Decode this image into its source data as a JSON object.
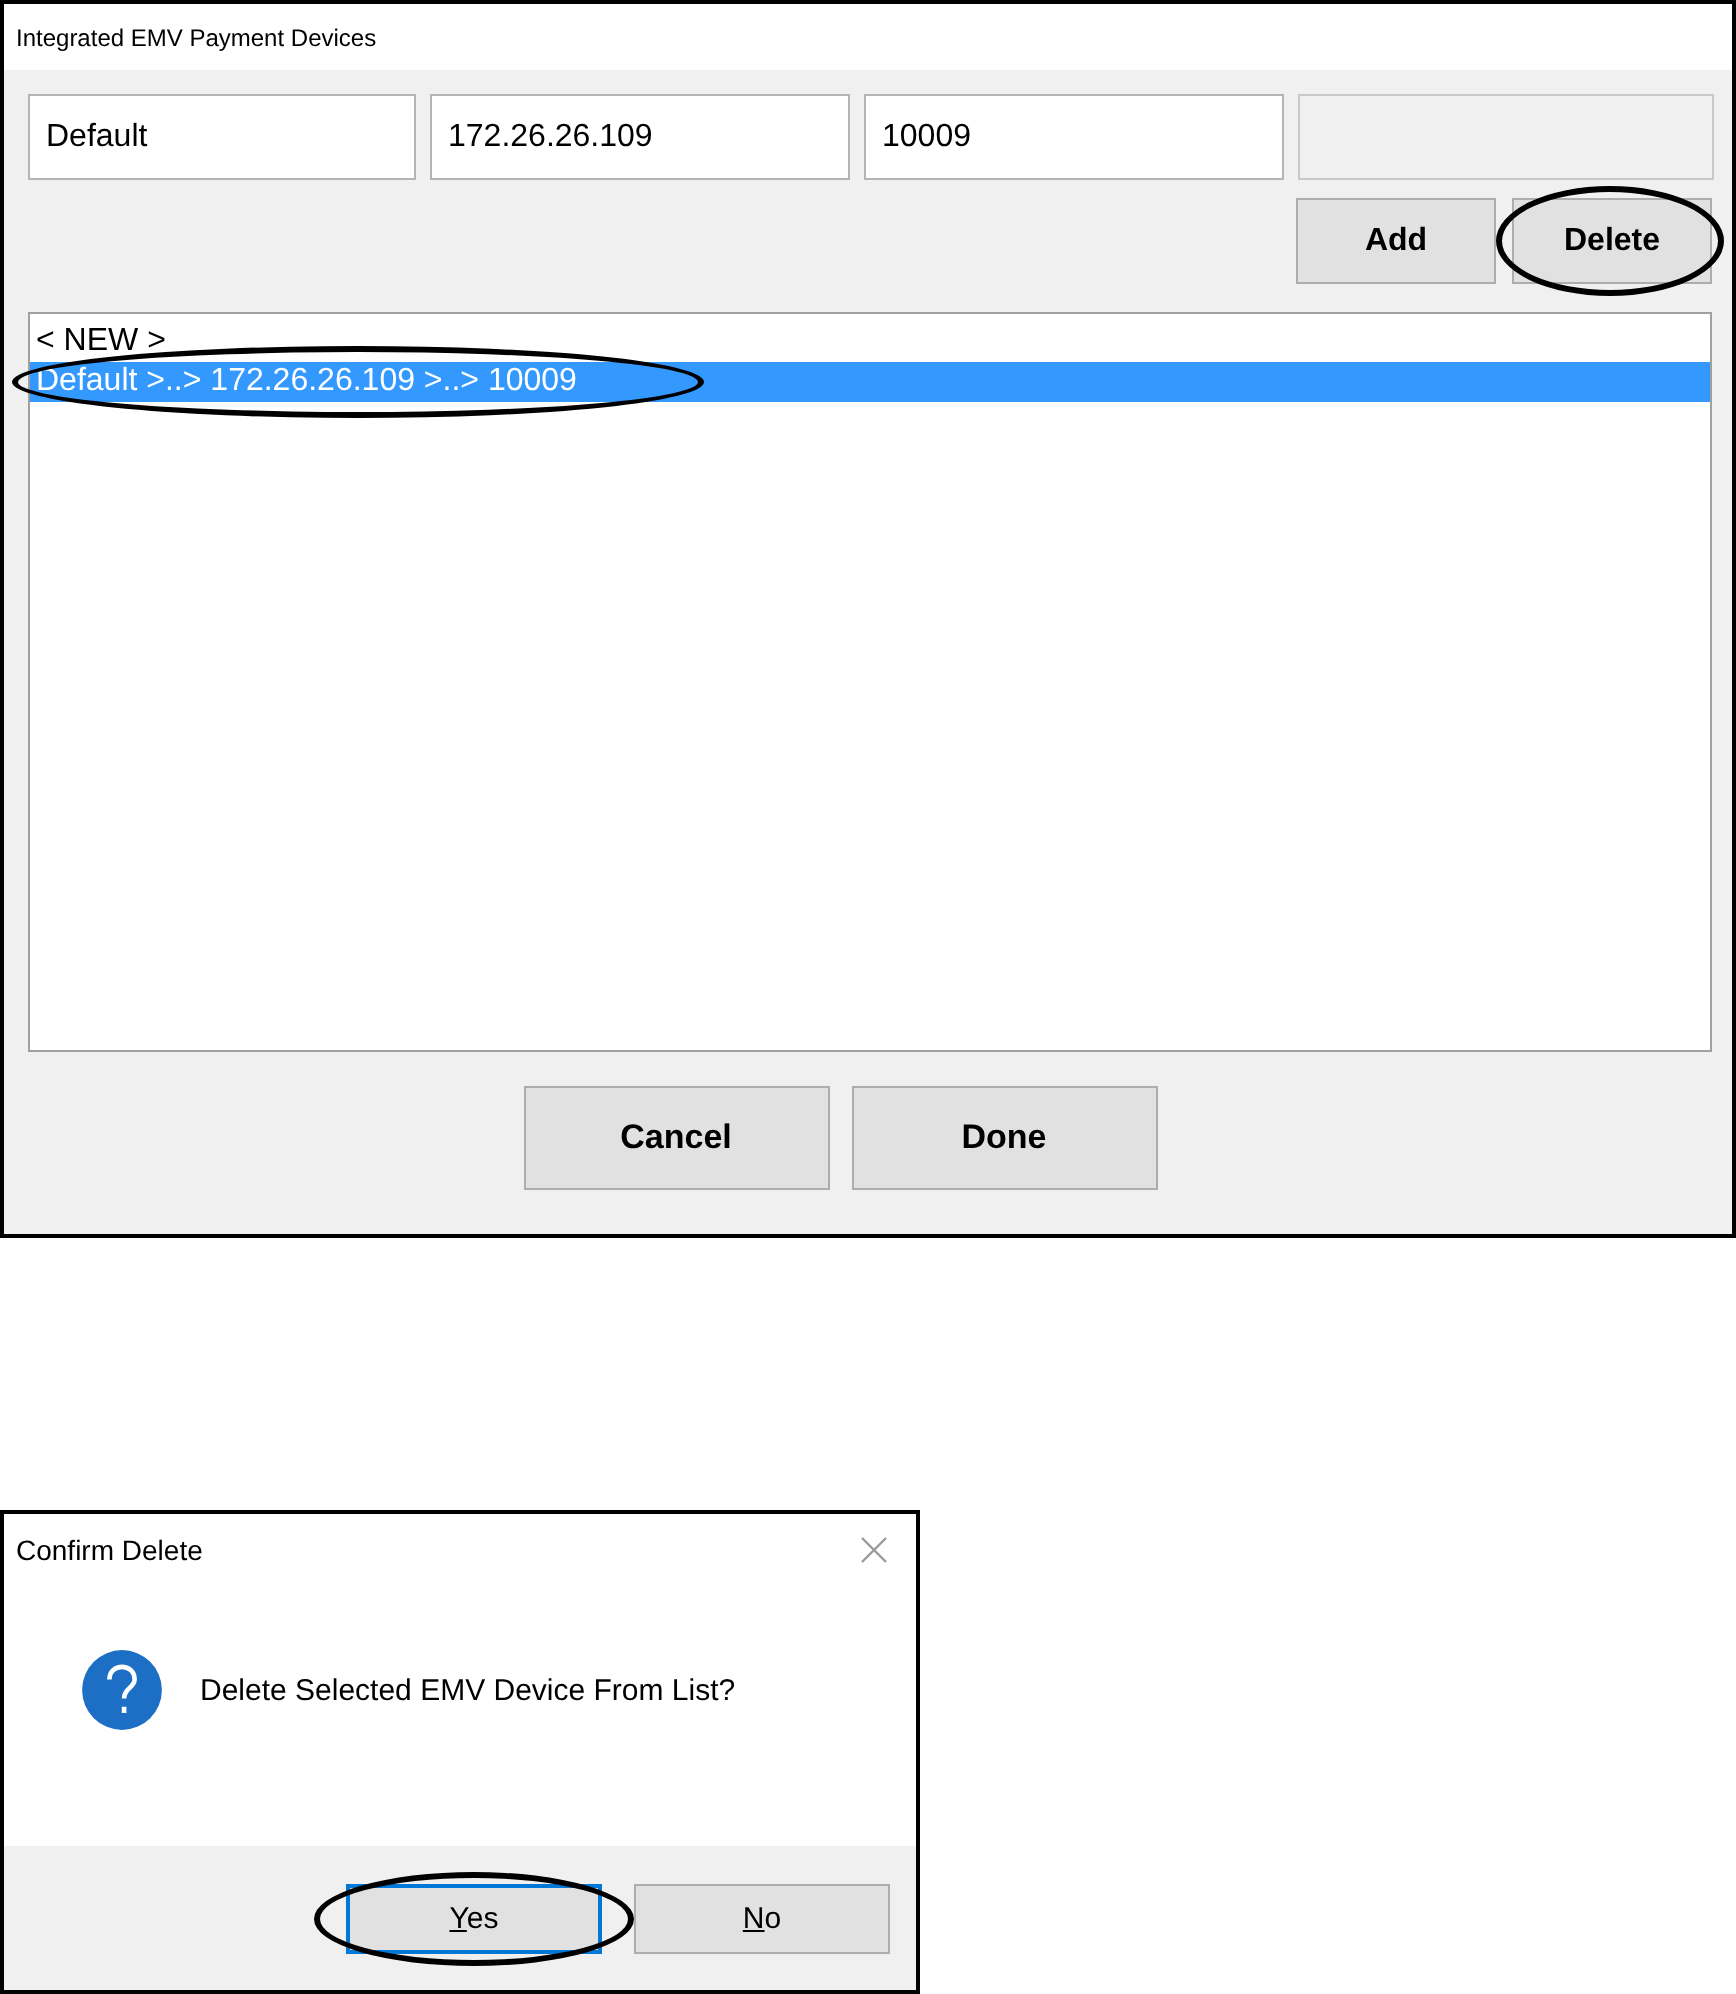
{
  "main_window": {
    "title": "Integrated EMV Payment Devices",
    "fields": [
      {
        "value": "Default",
        "disabled": false
      },
      {
        "value": "172.26.26.109",
        "disabled": false
      },
      {
        "value": "10009",
        "disabled": false
      },
      {
        "disabled": true
      }
    ],
    "buttons": [
      {
        "label": "Add",
        "circled": false
      },
      {
        "label": "Delete",
        "circled": true
      }
    ],
    "list": [
      {
        "text": "< NEW >",
        "selected": false,
        "circled": false
      },
      {
        "text": "Default >..> 172.26.26.109 >..> 10009",
        "selected": true,
        "circled": true
      }
    ],
    "footer_buttons": [
      {
        "label": "Cancel"
      },
      {
        "label": "Done"
      }
    ]
  },
  "confirm_dialog": {
    "title": "Confirm Delete",
    "message": "Delete Selected EMV Device From List?",
    "buttons": [
      {
        "label": "Yes",
        "mnemonic": true,
        "default": true,
        "circled": true
      },
      {
        "label": "No",
        "mnemonic": true,
        "default": false,
        "circled": false
      }
    ]
  }
}
